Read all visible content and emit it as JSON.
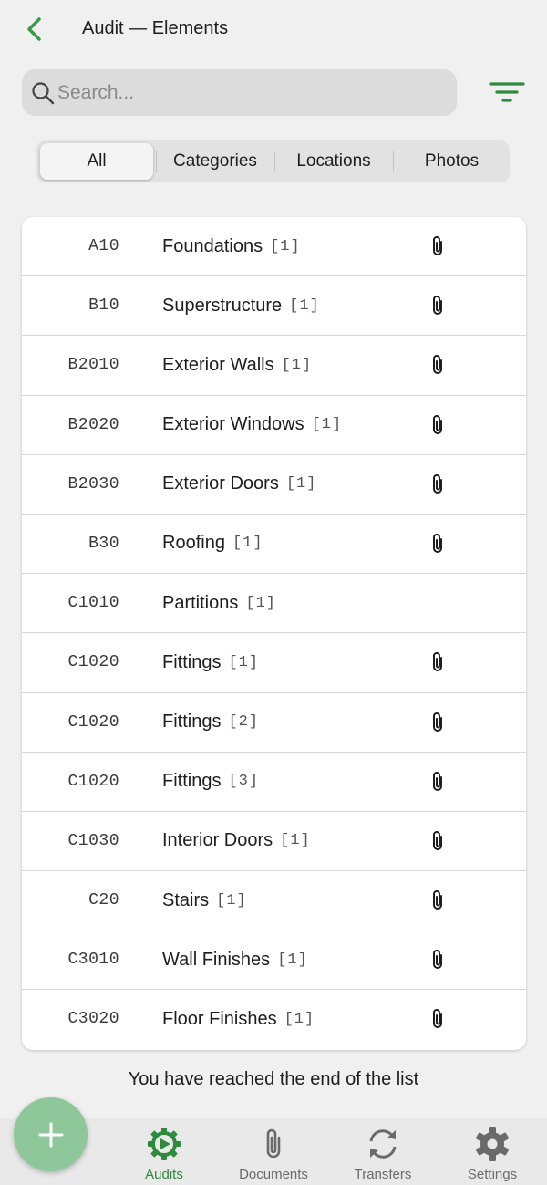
{
  "header": {
    "title": "Audit — Elements",
    "back_icon": "chevron-left-icon"
  },
  "search": {
    "placeholder": "Search...",
    "value": ""
  },
  "filter": {
    "icon": "filter-icon"
  },
  "tabs": [
    {
      "label": "All",
      "active": true
    },
    {
      "label": "Categories",
      "active": false
    },
    {
      "label": "Locations",
      "active": false
    },
    {
      "label": "Photos",
      "active": false
    }
  ],
  "rows": [
    {
      "code": "A10",
      "name": "Foundations",
      "count": "[1]",
      "attachment": true
    },
    {
      "code": "B10",
      "name": "Superstructure",
      "count": "[1]",
      "attachment": true
    },
    {
      "code": "B2010",
      "name": "Exterior Walls",
      "count": "[1]",
      "attachment": true
    },
    {
      "code": "B2020",
      "name": "Exterior Windows",
      "count": "[1]",
      "attachment": true
    },
    {
      "code": "B2030",
      "name": "Exterior Doors",
      "count": "[1]",
      "attachment": true
    },
    {
      "code": "B30",
      "name": "Roofing",
      "count": "[1]",
      "attachment": true
    },
    {
      "code": "C1010",
      "name": "Partitions",
      "count": "[1]",
      "attachment": false
    },
    {
      "code": "C1020",
      "name": "Fittings",
      "count": "[1]",
      "attachment": true
    },
    {
      "code": "C1020",
      "name": "Fittings",
      "count": "[2]",
      "attachment": true
    },
    {
      "code": "C1020",
      "name": "Fittings",
      "count": "[3]",
      "attachment": true
    },
    {
      "code": "C1030",
      "name": "Interior Doors",
      "count": "[1]",
      "attachment": true
    },
    {
      "code": "C20",
      "name": "Stairs",
      "count": "[1]",
      "attachment": true
    },
    {
      "code": "C3010",
      "name": "Wall Finishes",
      "count": "[1]",
      "attachment": true
    },
    {
      "code": "C3020",
      "name": "Floor Finishes",
      "count": "[1]",
      "attachment": true
    }
  ],
  "end_message": "You have reached the end of the list",
  "fab": {
    "icon": "plus-icon"
  },
  "nav": [
    {
      "label": "Audits",
      "icon": "audits-gear-icon",
      "active": true
    },
    {
      "label": "Documents",
      "icon": "paperclip-icon",
      "active": false
    },
    {
      "label": "Transfers",
      "icon": "sync-icon",
      "active": false
    },
    {
      "label": "Settings",
      "icon": "settings-gear-icon",
      "active": false
    }
  ],
  "colors": {
    "accent": "#2e8b3e",
    "fab": "#8ec79a",
    "background": "#f0f0f0",
    "search_bg": "#dcdcdc",
    "nav_bg": "#e9e9e9"
  }
}
